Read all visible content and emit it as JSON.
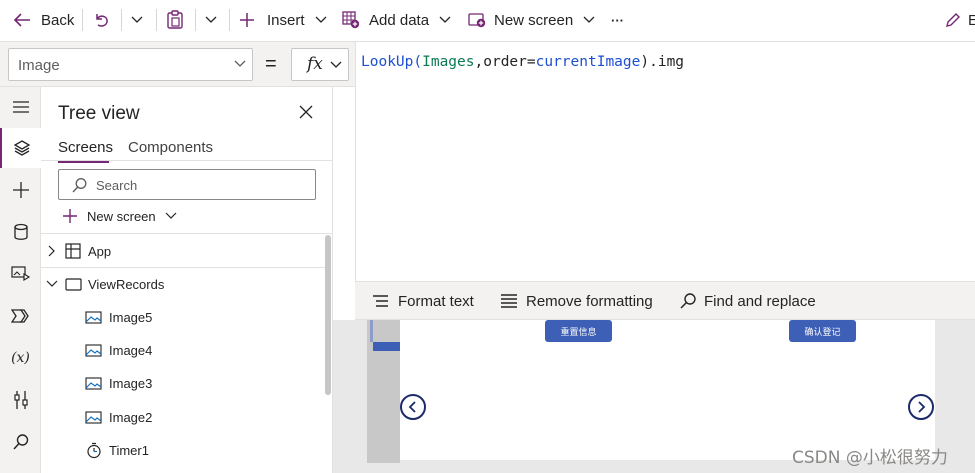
{
  "toolbar": {
    "back_label": "Back",
    "insert_label": "Insert",
    "add_data_label": "Add data",
    "new_screen_label": "New screen",
    "more_label": "···",
    "edit_label": "E"
  },
  "formula_bar": {
    "property": "Image",
    "equals": "=",
    "fx": "fx",
    "formula_tokens": [
      {
        "text": "LookUp(",
        "color": "#1d4fd2"
      },
      {
        "text": "Images",
        "color": "#0b7a55"
      },
      {
        "text": ",order=",
        "color": "#242424"
      },
      {
        "text": "currentImage",
        "color": "#1d4fd2"
      },
      {
        "text": ").img",
        "color": "#242424"
      }
    ]
  },
  "formula_toolbar": {
    "format_text": "Format text",
    "remove_formatting": "Remove formatting",
    "find_replace": "Find and replace"
  },
  "tree": {
    "title": "Tree view",
    "tabs": [
      "Screens",
      "Components"
    ],
    "active_tab": "Screens",
    "search_placeholder": "Search",
    "new_screen": "New screen",
    "nodes": [
      {
        "label": "App",
        "icon": "app-icon"
      },
      {
        "label": "ViewRecords",
        "icon": "screen-icon"
      },
      {
        "label": "Image5",
        "icon": "image-icon"
      },
      {
        "label": "Image4",
        "icon": "image-icon"
      },
      {
        "label": "Image3",
        "icon": "image-icon"
      },
      {
        "label": "Image2",
        "icon": "image-icon"
      },
      {
        "label": "Timer1",
        "icon": "timer-icon"
      }
    ]
  },
  "canvas": {
    "reset_button": "重置信息",
    "confirm_button": "确认登记"
  },
  "watermark": "CSDN @小松很努力",
  "colors": {
    "accent": "#742774",
    "canvas_button": "#3e5fb6",
    "nav_circle": "#1b2a6b"
  }
}
